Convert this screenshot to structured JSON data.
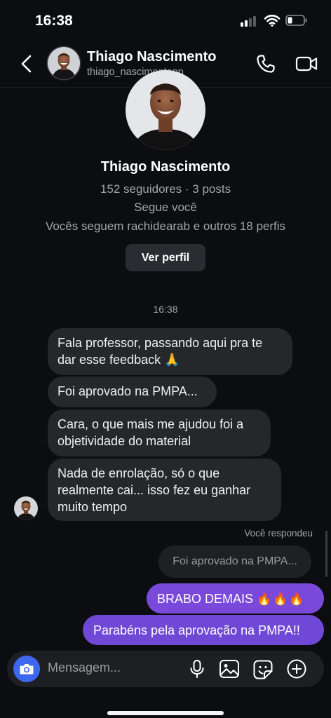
{
  "status_bar": {
    "time": "16:38"
  },
  "header": {
    "name": "Thiago Nascimento",
    "username": "thiago_nascimentopp",
    "icons": {
      "back": "chevron-left-icon",
      "call": "phone-icon",
      "video": "video-camera-icon"
    }
  },
  "profile": {
    "name": "Thiago Nascimento",
    "stats": "152 seguidores · 3 posts",
    "follows_you": "Segue você",
    "mutual": "Vocês seguem rachidearab e outros 18 perfis",
    "view_profile_label": "Ver perfil"
  },
  "thread": {
    "time_divider": "16:38",
    "incoming": [
      {
        "text": "Fala professor, passando aqui pra te dar esse feedback 🙏"
      },
      {
        "text": "Foi aprovado na PMPA..."
      },
      {
        "text": "Cara, o que mais me ajudou foi a objetividade do material"
      },
      {
        "text": "Nada de enrolação, só o que realmente cai... isso fez eu ganhar muito tempo"
      }
    ],
    "replied_label": "Você respondeu",
    "reply_quote": "Foi aprovado na PMPA...",
    "outgoing": [
      {
        "text": "BRABO DEMAIS",
        "emoji": "🔥🔥🔥"
      },
      {
        "text": "Parabéns pela aprovação na PMPA!!"
      }
    ]
  },
  "composer": {
    "placeholder": "Mensagem...",
    "icons": [
      "camera-icon",
      "microphone-icon",
      "image-icon",
      "sticker-icon",
      "plus-icon"
    ]
  },
  "colors": {
    "background": "#0c0d10",
    "incoming_bubble": "#26272b",
    "outgoing_bubble": "#7047d6",
    "camera_button": "#3d67ee"
  }
}
